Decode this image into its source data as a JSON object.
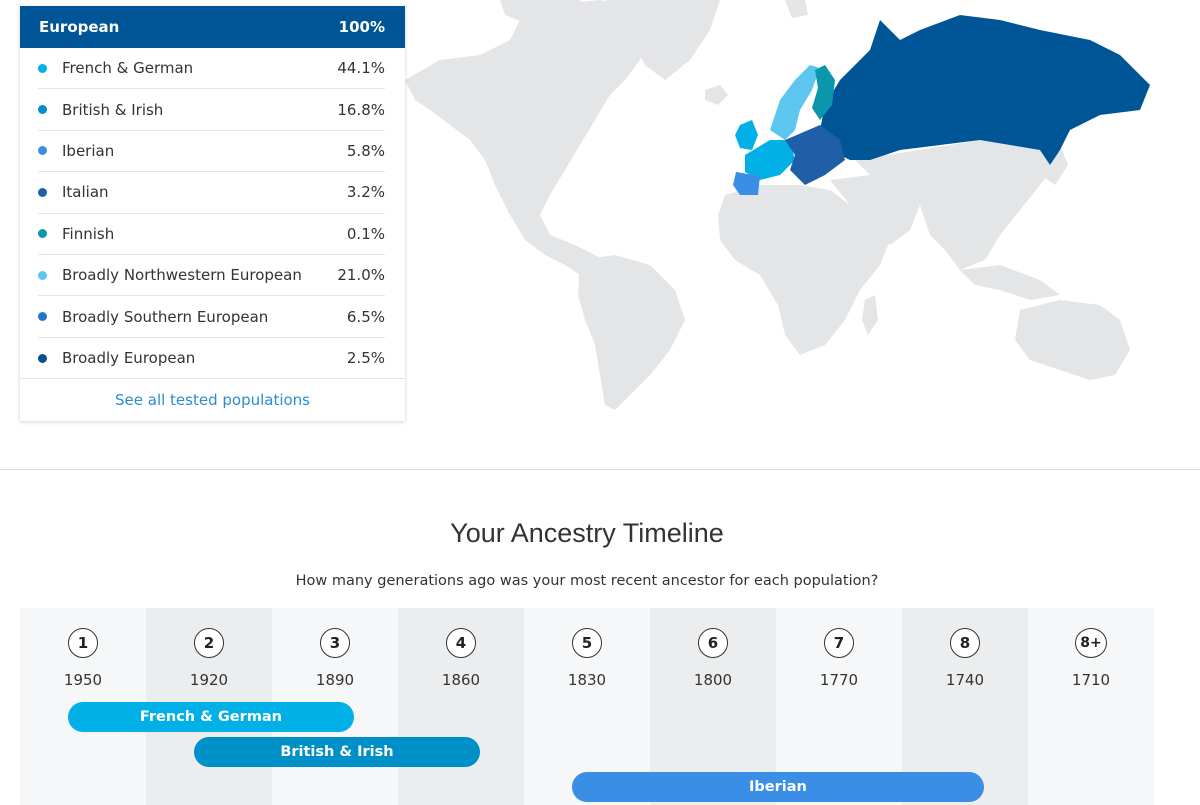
{
  "card": {
    "header": {
      "label": "European",
      "percent": "100%",
      "color": "#005596"
    },
    "populations": [
      {
        "name": "French & German",
        "percent": "44.1%",
        "color": "#00b0e6"
      },
      {
        "name": "British & Irish",
        "percent": "16.8%",
        "color": "#0090c8"
      },
      {
        "name": "Iberian",
        "percent": "5.8%",
        "color": "#3a8ee6"
      },
      {
        "name": "Italian",
        "percent": "3.2%",
        "color": "#1f5fa8"
      },
      {
        "name": "Finnish",
        "percent": "0.1%",
        "color": "#0a97ab"
      },
      {
        "name": "Broadly Northwestern European",
        "percent": "21.0%",
        "color": "#5cc6ee"
      },
      {
        "name": "Broadly Southern European",
        "percent": "6.5%",
        "color": "#2575d0"
      },
      {
        "name": "Broadly European",
        "percent": "2.5%",
        "color": "#0b4e8a"
      }
    ],
    "see_all_label": "See all tested populations"
  },
  "timeline": {
    "title": "Your Ancestry Timeline",
    "subtitle": "How many generations ago was your most recent ancestor for each population?",
    "generations": [
      {
        "gen": "1",
        "year": "1950"
      },
      {
        "gen": "2",
        "year": "1920"
      },
      {
        "gen": "3",
        "year": "1890"
      },
      {
        "gen": "4",
        "year": "1860"
      },
      {
        "gen": "5",
        "year": "1830"
      },
      {
        "gen": "6",
        "year": "1800"
      },
      {
        "gen": "7",
        "year": "1770"
      },
      {
        "gen": "8",
        "year": "1740"
      },
      {
        "gen": "8+",
        "year": "1710"
      }
    ],
    "bars": [
      {
        "label": "French & German",
        "from_gen": 1,
        "to_gen": 3.15,
        "color": "#00b0e6"
      },
      {
        "label": "British & Irish",
        "from_gen": 2,
        "to_gen": 4.15,
        "color": "#0090c8"
      },
      {
        "label": "Iberian",
        "from_gen": 5,
        "to_gen": 8.15,
        "color": "#3a8ee6"
      }
    ]
  },
  "map": {
    "land_color": "#e4e5e7",
    "russia_color": "#005596",
    "scandinavia_color": "#5cc6ee",
    "finland_color": "#0a97ab",
    "western_europe_color": "#00b0e6",
    "iberia_color": "#3a8ee6",
    "central_europe_color": "#1f5fa8"
  }
}
